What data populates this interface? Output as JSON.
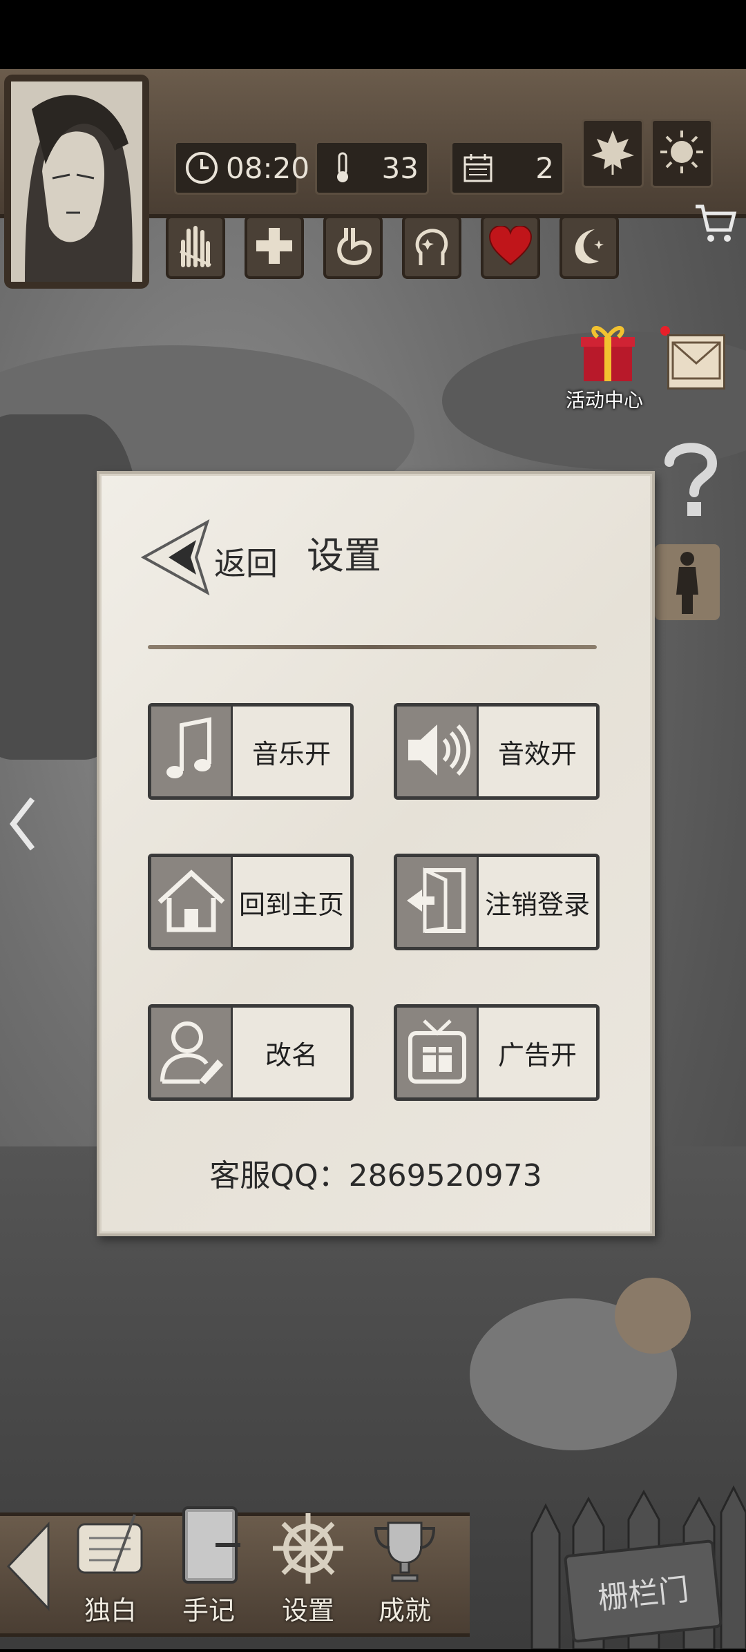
{
  "hud": {
    "time": "08:20",
    "temperature": "33",
    "day": "2",
    "season_icon": "maple-leaf-icon",
    "weather_icon": "sun-icon"
  },
  "activity_center_label": "活动中心",
  "dialog": {
    "back_label": "返回",
    "title": "设置",
    "options": [
      {
        "label": "音乐开",
        "icon": "music-note-icon"
      },
      {
        "label": "音效开",
        "icon": "speaker-icon"
      },
      {
        "label": "回到主页",
        "icon": "home-icon"
      },
      {
        "label": "注销登录",
        "icon": "logout-door-icon"
      },
      {
        "label": "改名",
        "icon": "user-edit-icon"
      },
      {
        "label": "广告开",
        "icon": "tv-gift-icon"
      }
    ],
    "support": "客服QQ：2869520973"
  },
  "bottom_nav": [
    {
      "label": "独白",
      "icon": "scroll-quill-icon"
    },
    {
      "label": "手记",
      "icon": "notebook-icon"
    },
    {
      "label": "设置",
      "icon": "ship-wheel-icon"
    },
    {
      "label": "成就",
      "icon": "trophy-icon"
    }
  ],
  "gate_sign": "栅栏门"
}
